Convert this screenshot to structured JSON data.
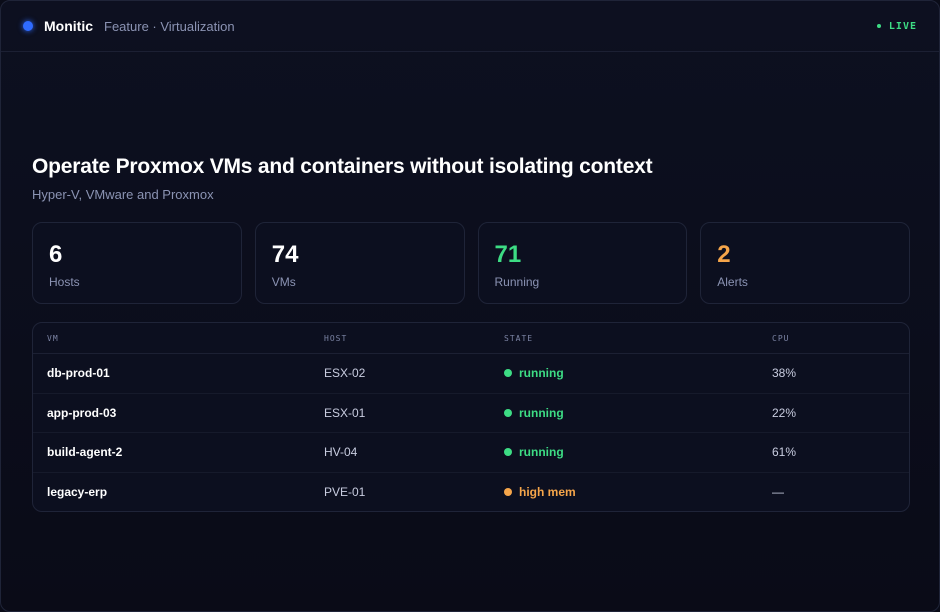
{
  "app": {
    "name": "Monitic",
    "breadcrumb": "Feature · Virtualization",
    "live_label": "LIVE"
  },
  "hero": {
    "title": "Operate Proxmox VMs and containers without isolating context",
    "subtitle": "Hyper-V, VMware and Proxmox"
  },
  "stats": [
    {
      "value": "6",
      "label": "Hosts",
      "color": "#ffffff"
    },
    {
      "value": "74",
      "label": "VMs",
      "color": "#ffffff"
    },
    {
      "value": "71",
      "label": "Running",
      "color": "#3ddc84"
    },
    {
      "value": "2",
      "label": "Alerts",
      "color": "#f5a54a"
    }
  ],
  "table": {
    "columns": [
      "VM",
      "HOST",
      "STATE",
      "CPU"
    ],
    "rows": [
      {
        "vm": "db-prod-01",
        "host": "ESX-02",
        "state": "running",
        "state_color": "#3ddc84",
        "cpu": "38%"
      },
      {
        "vm": "app-prod-03",
        "host": "ESX-01",
        "state": "running",
        "state_color": "#3ddc84",
        "cpu": "22%"
      },
      {
        "vm": "build-agent-2",
        "host": "HV-04",
        "state": "running",
        "state_color": "#3ddc84",
        "cpu": "61%"
      },
      {
        "vm": "legacy-erp",
        "host": "PVE-01",
        "state": "high mem",
        "state_color": "#f5a54a",
        "cpu": "—"
      }
    ]
  },
  "colors": {
    "accent": "#2f6bff",
    "ok": "#3ddc84",
    "warn": "#f5a54a"
  }
}
